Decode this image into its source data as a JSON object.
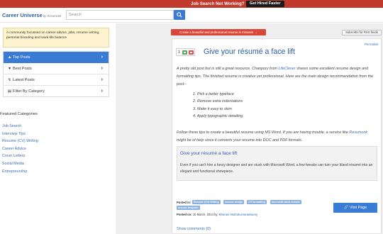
{
  "topbar": {
    "message": "Job Search Not Working?",
    "cta": "Get Hired Faster"
  },
  "header": {
    "logo": "Career Universe",
    "logo_by": "by Resumonk",
    "search_placeholder": "Search"
  },
  "sidebar": {
    "about": "A community focussed on career advice, jobs, resume writing, personal branding and work-life balance",
    "menu": [
      {
        "label": "Top Posts",
        "icon": "thumbs-up-icon"
      },
      {
        "label": "Best Posts",
        "icon": "heart-icon"
      },
      {
        "label": "Latest Posts",
        "icon": "bolt-icon"
      },
      {
        "label": "Filter By Category",
        "icon": "filter-icon"
      }
    ],
    "featured_title": "Featured Categories",
    "featured": [
      "Job Search",
      "Interview Tips",
      "Resume (CV) Writing",
      "Career Advice",
      "Cover Letters",
      "Social Media",
      "Entrepreurship"
    ]
  },
  "content": {
    "banner": "Create a beautiful and professional resume in minutes! →",
    "rss": "Subscribe for RSS feeds",
    "permalink": "Permalink"
  },
  "post": {
    "votes": "1",
    "title": "Give your résumé a face lift",
    "intro_1": "A pretty old post but is still a great resource. Chanpory from ",
    "intro_link": "LifeClever",
    "intro_2": " shares some excellent resume design and formatting tips. The finished resume is creative yet professional. Here are the main design recommendation from the post:-",
    "steps": [
      "Pick a better typeface",
      "Remove extra indentations",
      "Make it easy to skim",
      "Apply typographic detailing"
    ],
    "outro_1": "Follow these tips to create a beautiful resume using MS Word. If you are having trouble, a service like ",
    "outro_link": "Resumonk",
    "outro_2": " might be of help since it converts your resume into DOC and PDF formats.",
    "quote_title": "Give your résumé a face lift",
    "quote_body": "Even if you can't hire a fancy designer and are stuck with Microsoft Word, a few tweaks can turn your bland résumé into an elegant and functional showpiece.",
    "posted_in_label": "Posted in:",
    "tags": [
      "Resume (CV) Writing",
      "resume design",
      "CV formatting",
      "microsoft word resume",
      "resume template"
    ],
    "posted_on_label": "Posted on:",
    "posted_on": "10 March, 2014",
    "by_label": "by:",
    "author": "Bharani Muthukumaraswamy",
    "visit_label": "Visit Page",
    "comments": "Show comments (0)"
  }
}
